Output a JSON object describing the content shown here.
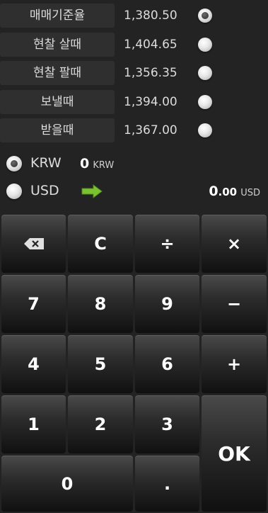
{
  "rates": [
    {
      "label": "매매기준율",
      "value": "1,380.50",
      "selected": true
    },
    {
      "label": "현찰 살때",
      "value": "1,404.65",
      "selected": false
    },
    {
      "label": "현찰 팔때",
      "value": "1,356.35",
      "selected": false
    },
    {
      "label": "보낼때",
      "value": "1,394.00",
      "selected": false
    },
    {
      "label": "받을때",
      "value": "1,367.00",
      "selected": false
    }
  ],
  "currencies": {
    "krw": {
      "code": "KRW",
      "amount": "0",
      "unit": "KRW",
      "selected": true
    },
    "usd": {
      "code": "USD",
      "amount_int": "0",
      "amount_dec": ".00",
      "unit": "USD",
      "selected": false
    }
  },
  "keypad": {
    "backspace_icon": "backspace-icon",
    "clear": "C",
    "divide": "÷",
    "multiply": "×",
    "seven": "7",
    "eight": "8",
    "nine": "9",
    "minus": "−",
    "four": "4",
    "five": "5",
    "six": "6",
    "plus": "+",
    "one": "1",
    "two": "2",
    "three": "3",
    "ok": "OK",
    "zero": "0",
    "dot": "."
  },
  "colors": {
    "arrow": "#7ac230",
    "background": "#232323"
  }
}
